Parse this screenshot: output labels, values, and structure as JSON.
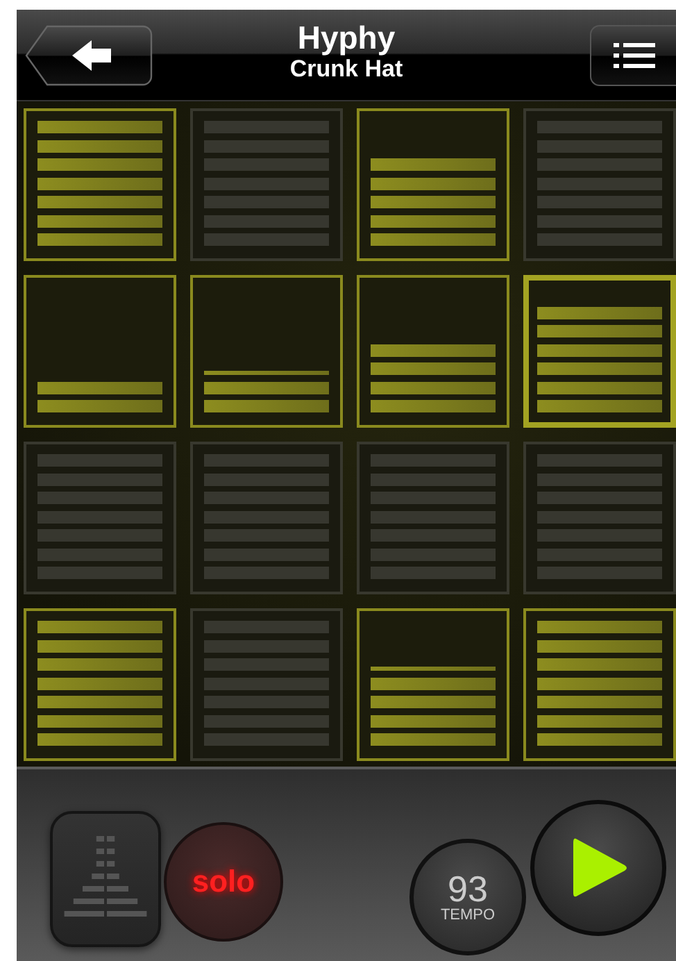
{
  "header": {
    "title": "Hyphy",
    "subtitle": "Crunk Hat"
  },
  "pads": [
    {
      "on": true,
      "selected": false,
      "bars": [
        {
          "kind": "full"
        },
        {
          "kind": "full"
        },
        {
          "kind": "full"
        },
        {
          "kind": "full"
        },
        {
          "kind": "full"
        },
        {
          "kind": "full"
        },
        {
          "kind": "full"
        }
      ]
    },
    {
      "on": false,
      "selected": false
    },
    {
      "on": true,
      "selected": false,
      "bars": [
        {
          "kind": "full"
        },
        {
          "kind": "full"
        },
        {
          "kind": "full"
        },
        {
          "kind": "full"
        },
        {
          "kind": "full"
        }
      ]
    },
    {
      "on": false,
      "selected": false
    },
    {
      "on": true,
      "selected": false,
      "bars": [
        {
          "kind": "full"
        },
        {
          "kind": "full"
        }
      ]
    },
    {
      "on": true,
      "selected": false,
      "bars": [
        {
          "kind": "full"
        },
        {
          "kind": "full"
        },
        {
          "kind": "thin"
        }
      ]
    },
    {
      "on": true,
      "selected": false,
      "bars": [
        {
          "kind": "full"
        },
        {
          "kind": "full"
        },
        {
          "kind": "full"
        },
        {
          "kind": "full"
        }
      ]
    },
    {
      "on": true,
      "selected": true,
      "bars": [
        {
          "kind": "full"
        },
        {
          "kind": "full"
        },
        {
          "kind": "full"
        },
        {
          "kind": "full"
        },
        {
          "kind": "full"
        },
        {
          "kind": "full"
        }
      ]
    },
    {
      "on": false,
      "selected": false
    },
    {
      "on": false,
      "selected": false
    },
    {
      "on": false,
      "selected": false
    },
    {
      "on": false,
      "selected": false
    },
    {
      "on": true,
      "selected": false,
      "bars": [
        {
          "kind": "full"
        },
        {
          "kind": "full"
        },
        {
          "kind": "full"
        },
        {
          "kind": "full"
        },
        {
          "kind": "full"
        },
        {
          "kind": "full"
        },
        {
          "kind": "full"
        }
      ]
    },
    {
      "on": false,
      "selected": false
    },
    {
      "on": true,
      "selected": false,
      "bars": [
        {
          "kind": "full"
        },
        {
          "kind": "full"
        },
        {
          "kind": "full"
        },
        {
          "kind": "full"
        },
        {
          "kind": "thin"
        }
      ]
    },
    {
      "on": true,
      "selected": false,
      "bars": [
        {
          "kind": "full"
        },
        {
          "kind": "full"
        },
        {
          "kind": "full"
        },
        {
          "kind": "full"
        },
        {
          "kind": "full"
        },
        {
          "kind": "full"
        },
        {
          "kind": "full"
        }
      ]
    }
  ],
  "controls": {
    "solo_label": "solo",
    "tempo": "93",
    "tempo_label": "TEMPO"
  }
}
